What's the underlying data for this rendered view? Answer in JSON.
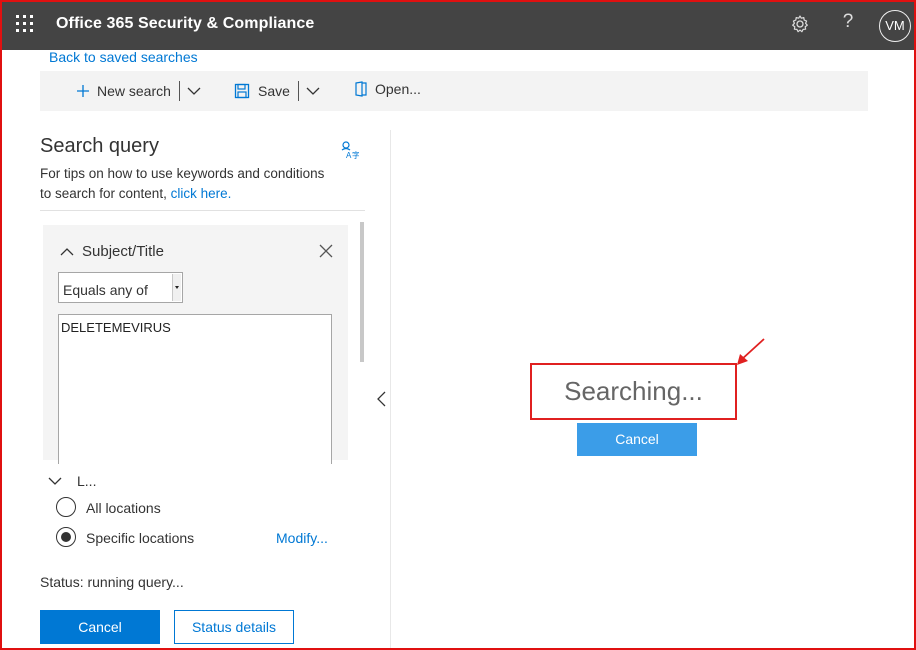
{
  "app": {
    "title": "Office 365 Security & Compliance",
    "user_initials": "VM"
  },
  "nav": {
    "back_link": "Back to saved searches"
  },
  "toolbar": {
    "new_search": "New search",
    "save": "Save",
    "open": "Open..."
  },
  "search_query": {
    "title": "Search query",
    "tip_text": "For tips on how to use keywords and conditions to search for content, ",
    "tip_link": "click here.",
    "condition": {
      "title": "Subject/Title",
      "operator": "Equals any of",
      "value": "DELETEMEVIRUS"
    },
    "locations": {
      "label": "L...",
      "options": [
        "All locations",
        "Specific locations"
      ],
      "selected": "Specific locations",
      "modify": "Modify..."
    },
    "status": "Status: running query...",
    "cancel_label": "Cancel",
    "status_details_label": "Status details"
  },
  "results": {
    "searching_text": "Searching...",
    "cancel_label": "Cancel"
  },
  "colors": {
    "accent": "#0078d4",
    "topbar": "#444444",
    "annotation": "#e02020"
  }
}
